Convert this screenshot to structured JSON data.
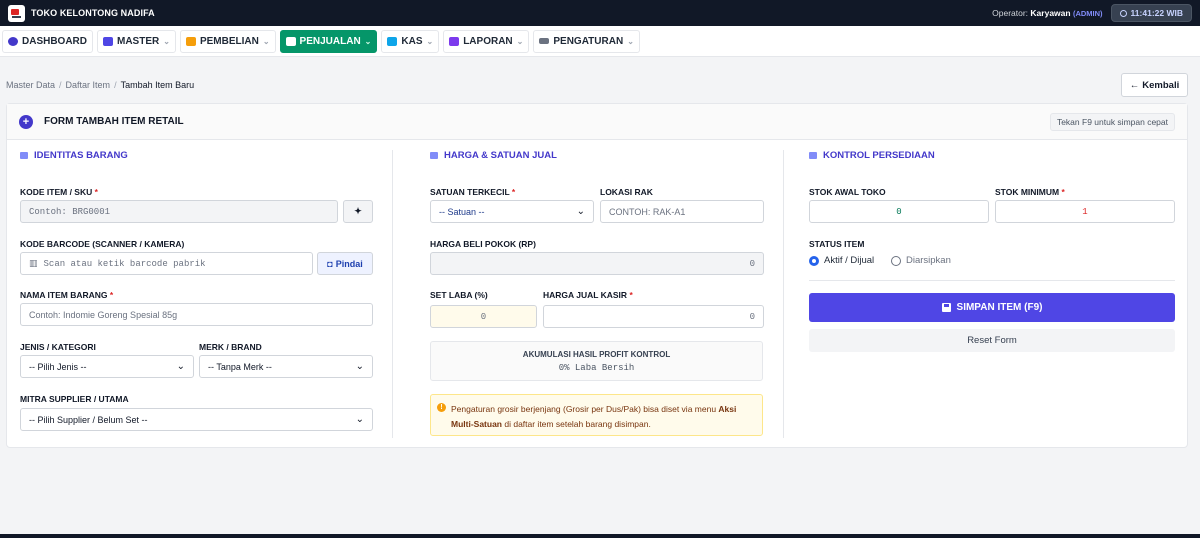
{
  "app": {
    "title": "TOKO KELONTONG NADIFA"
  },
  "topbar": {
    "operator_label": "Operator:",
    "operator_name": "Karyawan",
    "operator_role": "(ADMIN)",
    "clock": "11:41:22 WIB"
  },
  "nav": {
    "items": [
      {
        "label": "DASHBOARD",
        "icon": "dashboard-icon"
      },
      {
        "label": "MASTER",
        "icon": "database-icon"
      },
      {
        "label": "PEMBELIAN",
        "icon": "truck-icon"
      },
      {
        "label": "PENJUALAN",
        "icon": "cart-icon",
        "active": true
      },
      {
        "label": "KAS",
        "icon": "wallet-icon"
      },
      {
        "label": "LAPORAN",
        "icon": "report-icon"
      },
      {
        "label": "PENGATURAN",
        "icon": "sliders-icon"
      }
    ]
  },
  "breadcrumb": [
    "Master Data",
    "Daftar Item",
    "Tambah Item Baru"
  ],
  "back_button": "Kembali",
  "form": {
    "title": "FORM TAMBAH ITEM RETAIL",
    "hint": "Tekan F9 untuk simpan cepat",
    "identitas": {
      "heading": "IDENTITAS BARANG",
      "kode_label": "KODE ITEM / SKU",
      "kode_placeholder": "Contoh: BRG0001",
      "barcode_label": "KODE BARCODE (SCANNER / KAMERA)",
      "barcode_placeholder": "Scan atau ketik barcode pabrik",
      "scan_button": "Pindai",
      "nama_label": "NAMA ITEM BARANG",
      "nama_placeholder": "Contoh: Indomie Goreng Spesial 85g",
      "jenis_label": "JENIS / KATEGORI",
      "jenis_value": "-- Pilih Jenis --",
      "merk_label": "MERK / BRAND",
      "merk_value": "-- Tanpa Merk --",
      "supplier_label": "MITRA SUPPLIER / UTAMA",
      "supplier_value": "-- Pilih Supplier / Belum Set --"
    },
    "harga": {
      "heading": "HARGA & SATUAN JUAL",
      "satuan_label": "SATUAN TERKECIL",
      "satuan_value": "-- Satuan --",
      "rak_label": "LOKASI RAK",
      "rak_placeholder": "CONTOH: RAK-A1",
      "beli_label": "HARGA BELI POKOK (RP)",
      "beli_value": "0",
      "laba_label": "SET LABA (%)",
      "laba_value": "0",
      "jual_label": "HARGA JUAL KASIR",
      "jual_value": "0",
      "akumulasi_title": "AKUMULASI HASIL PROFIT KONTROL",
      "akumulasi_value": "0% Laba Bersih",
      "note_1": "Pengaturan grosir berjenjang (Grosir per Dus/Pak) bisa diset via menu ",
      "note_bold": "Aksi Multi-Satuan",
      "note_2": " di daftar item setelah barang disimpan."
    },
    "persediaan": {
      "heading": "KONTROL PERSEDIAAN",
      "stok_awal_label": "STOK AWAL TOKO",
      "stok_awal_value": "0",
      "stok_min_label": "STOK MINIMUM",
      "stok_min_value": "1",
      "status_label": "STATUS ITEM",
      "status_options": [
        "Aktif / Dijual",
        "Diarsipkan"
      ],
      "save_button": "SIMPAN ITEM (F9)",
      "reset_button": "Reset Form"
    }
  },
  "colors": {
    "topbar": "#111827",
    "accent": "#4f46e5",
    "active_nav": "#059669",
    "required": "#dc2626"
  }
}
